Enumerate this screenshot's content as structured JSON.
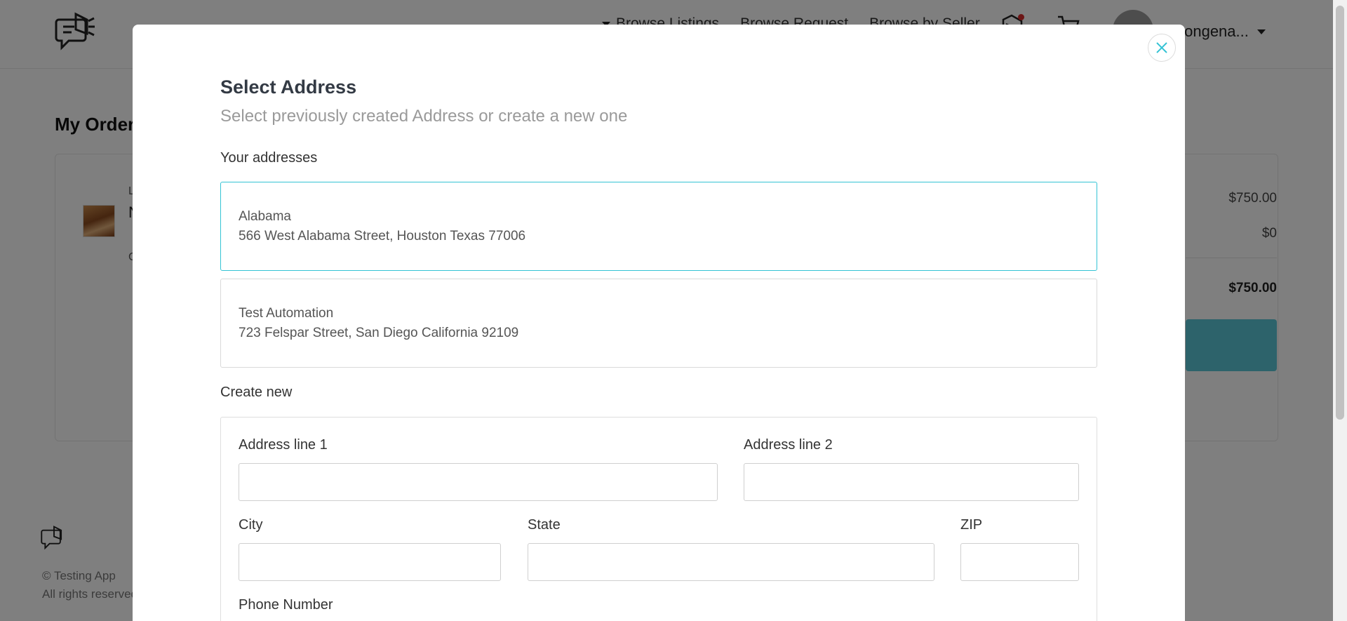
{
  "header": {
    "nav": {
      "browse_listings": "Browse Listings",
      "browse_request": "Browse Request",
      "browse_by_seller": "Browse by Seller"
    },
    "username": "tongena..."
  },
  "page": {
    "title": "My Order",
    "order_fragment_1": "L",
    "order_fragment_2": "N",
    "order_fragment_3": "C",
    "summary": {
      "subtotal": "$750.00",
      "shipping": "$0",
      "total": "$750.00"
    }
  },
  "footer": {
    "copyright": "© Testing App",
    "rights": "All rights reserved"
  },
  "modal": {
    "title": "Select Address",
    "subtitle": "Select previously created Address or create a new one",
    "your_addresses_label": "Your addresses",
    "addresses": [
      {
        "name": "Alabama",
        "line": "566 West Alabama Street, Houston Texas 77006"
      },
      {
        "name": "Test Automation",
        "line": "723 Felspar Street, San Diego California 92109"
      }
    ],
    "selected_address_index": 0,
    "create_new_label": "Create new",
    "form": {
      "address_line_1": {
        "label": "Address line 1",
        "value": ""
      },
      "address_line_2": {
        "label": "Address line 2",
        "value": ""
      },
      "city": {
        "label": "City",
        "value": ""
      },
      "state": {
        "label": "State",
        "value": ""
      },
      "zip": {
        "label": "ZIP",
        "value": ""
      },
      "phone": {
        "label": "Phone Number",
        "value": ""
      }
    }
  },
  "colors": {
    "accent": "#34c3d4",
    "checkout_button": "#5bc7d6",
    "notification_dot": "#d92d2d",
    "overlay": "rgba(0,0,0,0.5)"
  },
  "icons": {
    "logo": "megaphone-chat-icon",
    "notifications": "tag-icon",
    "cart": "cart-icon",
    "close": "close-icon"
  }
}
